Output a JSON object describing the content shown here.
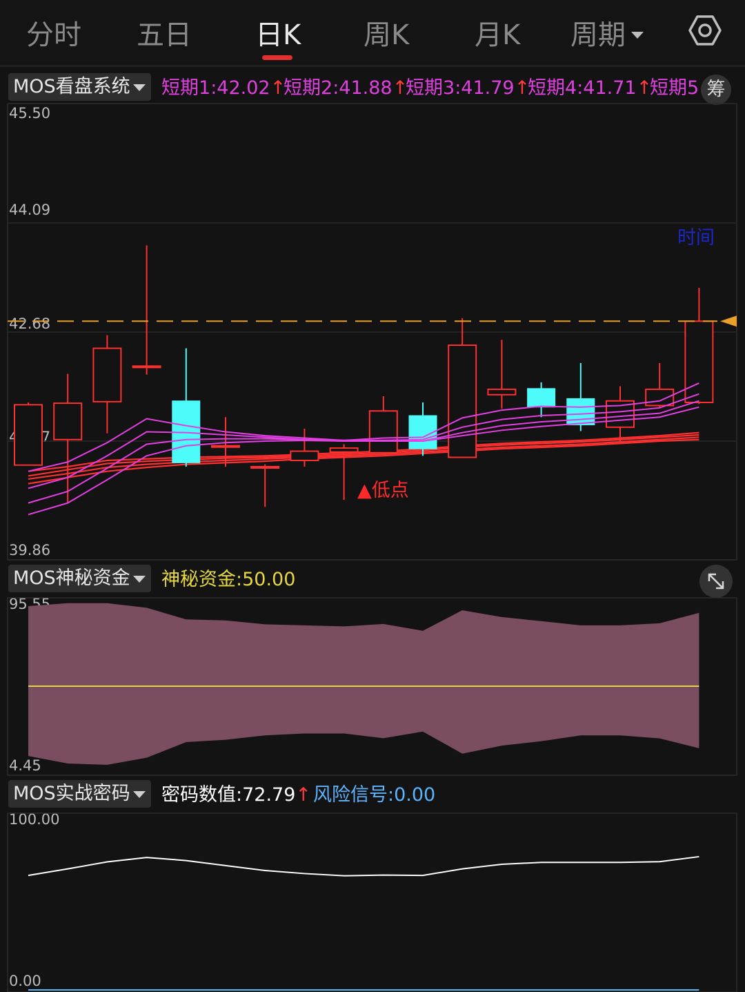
{
  "tabs": [
    {
      "label": "分时",
      "active": false
    },
    {
      "label": "五日",
      "active": false
    },
    {
      "label": "日K",
      "active": true
    },
    {
      "label": "周K",
      "active": false
    },
    {
      "label": "月K",
      "active": false
    },
    {
      "label": "周期",
      "active": false,
      "dropdown": true
    }
  ],
  "icons": {
    "settings": "gear-icon",
    "chip": "筹",
    "expand": "expand-icon"
  },
  "colors": {
    "up": "#ff3030",
    "down": "#4dfbfb",
    "ma": "#e33fe3",
    "ref_line": "#e8a02a",
    "fund_fill": "#7a4d60",
    "fund_line": "#e6d83c",
    "code_line": "#ffffff",
    "risk": "#5ab4ff"
  },
  "main": {
    "indicator": "MOS看盘系统",
    "ma_labels": [
      {
        "name": "短期1",
        "value": "42.02"
      },
      {
        "name": "短期2",
        "value": "41.88"
      },
      {
        "name": "短期3",
        "value": "41.79"
      },
      {
        "name": "短期4",
        "value": "41.71"
      },
      {
        "name": "短期5",
        "value": ""
      }
    ],
    "price_labels": [
      "45.50",
      "44.09",
      "42.68",
      "41.27",
      "39.86"
    ],
    "time_label": "时间",
    "low_marker": "▲低点",
    "ref_price": 42.82
  },
  "fund": {
    "indicator": "MOS神秘资金",
    "label": "神秘资金",
    "value": "50.00",
    "labels": [
      "95.55",
      "4.45"
    ]
  },
  "code": {
    "indicator": "MOS实战密码",
    "label": "密码数值",
    "value": "72.79",
    "risk_label": "风险信号",
    "risk_value": "0.00",
    "labels": [
      "100.00",
      "0.00"
    ]
  },
  "chart_data": [
    {
      "type": "candlestick",
      "ylim": [
        39.86,
        45.5
      ],
      "yticks": [
        45.5,
        44.09,
        42.68,
        41.27,
        39.86
      ],
      "candles": [
        {
          "o": 40.96,
          "c": 41.74,
          "h": 41.77,
          "l": 40.97
        },
        {
          "o": 41.29,
          "c": 41.76,
          "h": 42.14,
          "l": 40.47
        },
        {
          "o": 41.78,
          "c": 42.47,
          "h": 42.64,
          "l": 41.37
        },
        {
          "o": 42.24,
          "c": 42.24,
          "h": 43.8,
          "l": 42.13
        },
        {
          "o": 41.79,
          "c": 40.99,
          "h": 42.47,
          "l": 40.94
        },
        {
          "o": 41.21,
          "c": 41.21,
          "h": 41.58,
          "l": 40.94
        },
        {
          "o": 40.94,
          "c": 40.94,
          "h": 40.97,
          "l": 40.42
        },
        {
          "o": 41.02,
          "c": 41.14,
          "h": 41.43,
          "l": 40.94
        },
        {
          "o": 41.13,
          "c": 41.18,
          "h": 41.23,
          "l": 40.51
        },
        {
          "o": 41.12,
          "c": 41.66,
          "h": 41.85,
          "l": 41.12
        },
        {
          "o": 41.6,
          "c": 41.17,
          "h": 41.77,
          "l": 41.08
        },
        {
          "o": 41.06,
          "c": 42.51,
          "h": 42.86,
          "l": 41.06
        },
        {
          "o": 41.87,
          "c": 41.94,
          "h": 42.58,
          "l": 41.69
        },
        {
          "o": 41.95,
          "c": 41.71,
          "h": 42.03,
          "l": 41.58
        },
        {
          "o": 41.82,
          "c": 41.48,
          "h": 42.28,
          "l": 41.4
        },
        {
          "o": 41.45,
          "c": 41.79,
          "h": 41.98,
          "l": 41.23
        },
        {
          "o": 41.73,
          "c": 41.94,
          "h": 42.28,
          "l": 41.71
        },
        {
          "o": 41.77,
          "c": 42.82,
          "h": 43.25,
          "l": 41.75
        }
      ],
      "ma_series": [
        {
          "name": "短期1",
          "values": [
            40.88,
            41.0,
            41.25,
            41.56,
            41.47,
            41.39,
            41.34,
            41.31,
            41.28,
            41.31,
            41.32,
            41.57,
            41.67,
            41.72,
            41.71,
            41.73,
            41.79,
            42.02
          ]
        },
        {
          "name": "短期2",
          "values": [
            40.66,
            40.8,
            41.08,
            41.39,
            41.38,
            41.35,
            41.32,
            41.29,
            41.28,
            41.28,
            41.29,
            41.45,
            41.55,
            41.6,
            41.62,
            41.65,
            41.7,
            41.88
          ]
        },
        {
          "name": "短期3",
          "values": [
            40.47,
            40.62,
            40.92,
            41.23,
            41.29,
            41.3,
            41.3,
            41.29,
            41.27,
            41.27,
            41.27,
            41.38,
            41.47,
            41.52,
            41.55,
            41.59,
            41.63,
            41.79
          ]
        },
        {
          "name": "短期4",
          "values": [
            40.32,
            40.47,
            40.77,
            41.08,
            41.21,
            41.25,
            41.27,
            41.28,
            41.27,
            41.27,
            41.27,
            41.34,
            41.41,
            41.46,
            41.5,
            41.54,
            41.58,
            41.71
          ]
        },
        {
          "name": "",
          "values": [
            40.88,
            40.94,
            41.02,
            41.04,
            41.06,
            41.07,
            41.08,
            41.1,
            41.12,
            41.14,
            41.17,
            41.21,
            41.24,
            41.26,
            41.28,
            41.31,
            41.34,
            41.38
          ]
        },
        {
          "name": "",
          "values": [
            40.82,
            40.9,
            40.98,
            41.01,
            41.03,
            41.05,
            41.06,
            41.08,
            41.1,
            41.12,
            41.15,
            41.19,
            41.22,
            41.24,
            41.26,
            41.29,
            41.32,
            41.35
          ]
        },
        {
          "name": "",
          "values": [
            40.78,
            40.85,
            40.93,
            40.97,
            41.0,
            41.02,
            41.04,
            41.06,
            41.08,
            41.1,
            41.13,
            41.16,
            41.19,
            41.21,
            41.23,
            41.26,
            41.29,
            41.32
          ]
        },
        {
          "name": "",
          "values": [
            40.72,
            40.8,
            40.88,
            40.93,
            40.97,
            40.99,
            41.01,
            41.04,
            41.06,
            41.08,
            41.11,
            41.14,
            41.17,
            41.19,
            41.21,
            41.24,
            41.27,
            41.29
          ]
        }
      ]
    },
    {
      "type": "area",
      "ylim": [
        4.45,
        95.55
      ],
      "upper": [
        95.55,
        97.2,
        97.2,
        94.6,
        88.0,
        87.4,
        85.2,
        84.6,
        84.0,
        85.4,
        81.5,
        93.2,
        89.3,
        87.0,
        84.6,
        84.6,
        85.8,
        91.7
      ],
      "lower": [
        10.3,
        6.0,
        5.3,
        9.3,
        18.2,
        19.5,
        22.0,
        23.1,
        23.1,
        20.4,
        24.2,
        11.6,
        16.2,
        18.7,
        22.0,
        22.0,
        20.3,
        14.7
      ],
      "line": 50.0
    },
    {
      "type": "line",
      "ylim": [
        0,
        100
      ],
      "values": [
        67.7,
        71.6,
        75.7,
        78.3,
        76.5,
        73.5,
        70.6,
        68.8,
        67.5,
        67.9,
        67.7,
        71.6,
        74.3,
        75.4,
        75.4,
        75.4,
        75.8,
        78.8
      ],
      "risk": 0.0
    }
  ]
}
